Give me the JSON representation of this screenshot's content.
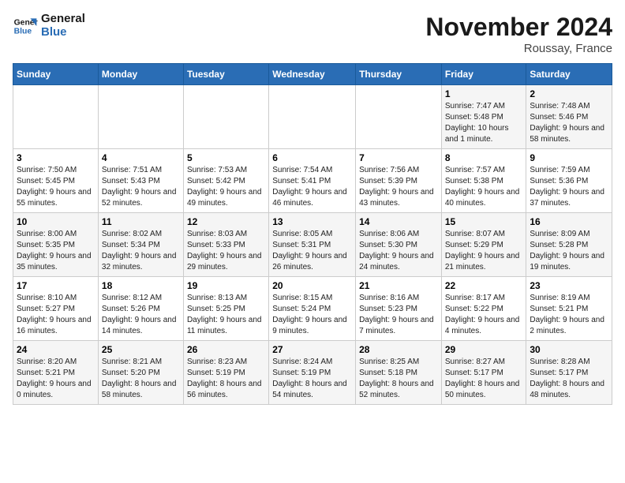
{
  "logo": {
    "line1": "General",
    "line2": "Blue"
  },
  "title": "November 2024",
  "location": "Roussay, France",
  "days_header": [
    "Sunday",
    "Monday",
    "Tuesday",
    "Wednesday",
    "Thursday",
    "Friday",
    "Saturday"
  ],
  "weeks": [
    [
      {
        "day": "",
        "info": ""
      },
      {
        "day": "",
        "info": ""
      },
      {
        "day": "",
        "info": ""
      },
      {
        "day": "",
        "info": ""
      },
      {
        "day": "",
        "info": ""
      },
      {
        "day": "1",
        "info": "Sunrise: 7:47 AM\nSunset: 5:48 PM\nDaylight: 10 hours and 1 minute."
      },
      {
        "day": "2",
        "info": "Sunrise: 7:48 AM\nSunset: 5:46 PM\nDaylight: 9 hours and 58 minutes."
      }
    ],
    [
      {
        "day": "3",
        "info": "Sunrise: 7:50 AM\nSunset: 5:45 PM\nDaylight: 9 hours and 55 minutes."
      },
      {
        "day": "4",
        "info": "Sunrise: 7:51 AM\nSunset: 5:43 PM\nDaylight: 9 hours and 52 minutes."
      },
      {
        "day": "5",
        "info": "Sunrise: 7:53 AM\nSunset: 5:42 PM\nDaylight: 9 hours and 49 minutes."
      },
      {
        "day": "6",
        "info": "Sunrise: 7:54 AM\nSunset: 5:41 PM\nDaylight: 9 hours and 46 minutes."
      },
      {
        "day": "7",
        "info": "Sunrise: 7:56 AM\nSunset: 5:39 PM\nDaylight: 9 hours and 43 minutes."
      },
      {
        "day": "8",
        "info": "Sunrise: 7:57 AM\nSunset: 5:38 PM\nDaylight: 9 hours and 40 minutes."
      },
      {
        "day": "9",
        "info": "Sunrise: 7:59 AM\nSunset: 5:36 PM\nDaylight: 9 hours and 37 minutes."
      }
    ],
    [
      {
        "day": "10",
        "info": "Sunrise: 8:00 AM\nSunset: 5:35 PM\nDaylight: 9 hours and 35 minutes."
      },
      {
        "day": "11",
        "info": "Sunrise: 8:02 AM\nSunset: 5:34 PM\nDaylight: 9 hours and 32 minutes."
      },
      {
        "day": "12",
        "info": "Sunrise: 8:03 AM\nSunset: 5:33 PM\nDaylight: 9 hours and 29 minutes."
      },
      {
        "day": "13",
        "info": "Sunrise: 8:05 AM\nSunset: 5:31 PM\nDaylight: 9 hours and 26 minutes."
      },
      {
        "day": "14",
        "info": "Sunrise: 8:06 AM\nSunset: 5:30 PM\nDaylight: 9 hours and 24 minutes."
      },
      {
        "day": "15",
        "info": "Sunrise: 8:07 AM\nSunset: 5:29 PM\nDaylight: 9 hours and 21 minutes."
      },
      {
        "day": "16",
        "info": "Sunrise: 8:09 AM\nSunset: 5:28 PM\nDaylight: 9 hours and 19 minutes."
      }
    ],
    [
      {
        "day": "17",
        "info": "Sunrise: 8:10 AM\nSunset: 5:27 PM\nDaylight: 9 hours and 16 minutes."
      },
      {
        "day": "18",
        "info": "Sunrise: 8:12 AM\nSunset: 5:26 PM\nDaylight: 9 hours and 14 minutes."
      },
      {
        "day": "19",
        "info": "Sunrise: 8:13 AM\nSunset: 5:25 PM\nDaylight: 9 hours and 11 minutes."
      },
      {
        "day": "20",
        "info": "Sunrise: 8:15 AM\nSunset: 5:24 PM\nDaylight: 9 hours and 9 minutes."
      },
      {
        "day": "21",
        "info": "Sunrise: 8:16 AM\nSunset: 5:23 PM\nDaylight: 9 hours and 7 minutes."
      },
      {
        "day": "22",
        "info": "Sunrise: 8:17 AM\nSunset: 5:22 PM\nDaylight: 9 hours and 4 minutes."
      },
      {
        "day": "23",
        "info": "Sunrise: 8:19 AM\nSunset: 5:21 PM\nDaylight: 9 hours and 2 minutes."
      }
    ],
    [
      {
        "day": "24",
        "info": "Sunrise: 8:20 AM\nSunset: 5:21 PM\nDaylight: 9 hours and 0 minutes."
      },
      {
        "day": "25",
        "info": "Sunrise: 8:21 AM\nSunset: 5:20 PM\nDaylight: 8 hours and 58 minutes."
      },
      {
        "day": "26",
        "info": "Sunrise: 8:23 AM\nSunset: 5:19 PM\nDaylight: 8 hours and 56 minutes."
      },
      {
        "day": "27",
        "info": "Sunrise: 8:24 AM\nSunset: 5:19 PM\nDaylight: 8 hours and 54 minutes."
      },
      {
        "day": "28",
        "info": "Sunrise: 8:25 AM\nSunset: 5:18 PM\nDaylight: 8 hours and 52 minutes."
      },
      {
        "day": "29",
        "info": "Sunrise: 8:27 AM\nSunset: 5:17 PM\nDaylight: 8 hours and 50 minutes."
      },
      {
        "day": "30",
        "info": "Sunrise: 8:28 AM\nSunset: 5:17 PM\nDaylight: 8 hours and 48 minutes."
      }
    ]
  ]
}
